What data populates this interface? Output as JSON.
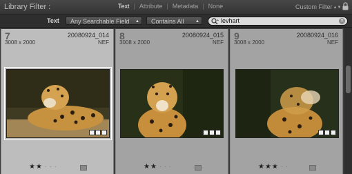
{
  "filter_bar": {
    "title": "Library Filter :",
    "tabs": [
      {
        "label": "Text",
        "active": true
      },
      {
        "label": "Attribute",
        "active": false
      },
      {
        "label": "Metadata",
        "active": false
      },
      {
        "label": "None",
        "active": false
      }
    ],
    "custom_filter": "Custom Filter"
  },
  "text_filter": {
    "label": "Text",
    "field_selector": "Any Searchable Field",
    "rule_selector": "Contains All",
    "search_value": "levhart"
  },
  "thumbnails": [
    {
      "index": "7",
      "filename": "20080924_014",
      "dimensions": "3008 x 2000",
      "type": "NEF",
      "rating": 2,
      "selected": true
    },
    {
      "index": "8",
      "filename": "20080924_015",
      "dimensions": "3008 x 2000",
      "type": "NEF",
      "rating": 2,
      "selected": false
    },
    {
      "index": "9",
      "filename": "20080924_016",
      "dimensions": "3008 x 2000",
      "type": "NEF",
      "rating": 3,
      "selected": false
    }
  ],
  "colors": {
    "selected_cell": "#bdbdbd",
    "cell": "#a3a3a3",
    "background": "#3a3a3a"
  }
}
